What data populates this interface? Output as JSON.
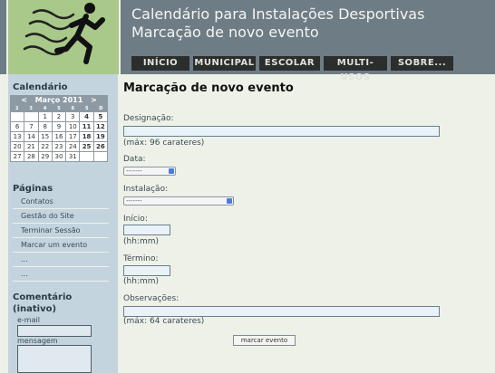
{
  "header": {
    "title_line1": "Calendário para Instalações Desportivas",
    "title_line2": "Marcação de novo evento",
    "nav": [
      "INÍCIO",
      "MUNICIPAL",
      "ESCOLAR",
      "MULTI-USOS",
      "SOBRE..."
    ]
  },
  "sidebar": {
    "calendar_heading": "Calendário",
    "calendar": {
      "prev": "<",
      "month": "Março 2011",
      "next": ">",
      "weekdays": [
        "2",
        "3",
        "4",
        "5",
        "6",
        "S",
        "D"
      ],
      "weeks": [
        [
          "",
          "",
          "1",
          "2",
          "3",
          "4",
          "5"
        ],
        [
          "6",
          "7",
          "8",
          "9",
          "10",
          "11",
          "12"
        ],
        [
          "13",
          "14",
          "15",
          "16",
          "17",
          "18",
          "19"
        ],
        [
          "20",
          "21",
          "22",
          "23",
          "24",
          "25",
          "26"
        ],
        [
          "27",
          "28",
          "29",
          "30",
          "31",
          "",
          ""
        ]
      ]
    },
    "pages_heading": "Páginas",
    "pages": [
      "Contatos",
      "Gestão do Site",
      "Terminar Sessão",
      "Marcar um evento",
      "...",
      "..."
    ],
    "comment_heading_line1": "Comentário",
    "comment_heading_line2": "(inativo)",
    "email_label": "e-mail",
    "message_label": "mensagem"
  },
  "main": {
    "title": "Marcação de novo evento",
    "designacao_label": "Designação:",
    "designacao_hint": "(máx: 96 carateres)",
    "data_label": "Data:",
    "data_value": "-------",
    "instalacao_label": "Instalação:",
    "instalacao_value": "-------",
    "inicio_label": "Início:",
    "inicio_hint": "(hh:mm)",
    "termino_label": "Término:",
    "termino_hint": "(hh:mm)",
    "observacoes_label": "Observações:",
    "observacoes_hint": "(máx: 64 carateres)",
    "submit_label": "marcar evento"
  }
}
